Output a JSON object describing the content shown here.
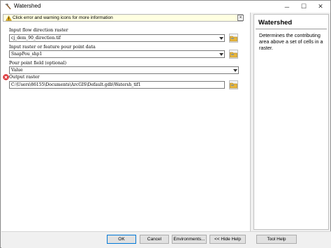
{
  "window": {
    "title": "Watershed"
  },
  "info_bar": {
    "text": "Click error and warning icons for more information"
  },
  "form": {
    "flow_direction": {
      "label": "Input flow direction raster",
      "value": "cj_dem_90_direction.tif"
    },
    "pour_point": {
      "label": "Input raster or feature pour point data",
      "value": "SnapPou_shp1"
    },
    "pour_point_field": {
      "label": "Pour point field (optional)",
      "value": "Value"
    },
    "output_raster": {
      "label": "Output raster",
      "value": "C:\\Users\\86155\\Documents\\ArcGIS\\Default.gdb\\Watersh_tif1"
    }
  },
  "help": {
    "title": "Watershed",
    "body": "Determines the contributing area above a set of cells in a raster."
  },
  "buttons": {
    "ok": "OK",
    "cancel": "Cancel",
    "environments": "Environments...",
    "hide_help": "<< Hide Help",
    "tool_help": "Tool Help"
  },
  "colors": {
    "info_bg": "#ffffe1",
    "error_red": "#d9262b",
    "folder_yellow": "#e8b53a",
    "accent": "#0078d7"
  }
}
